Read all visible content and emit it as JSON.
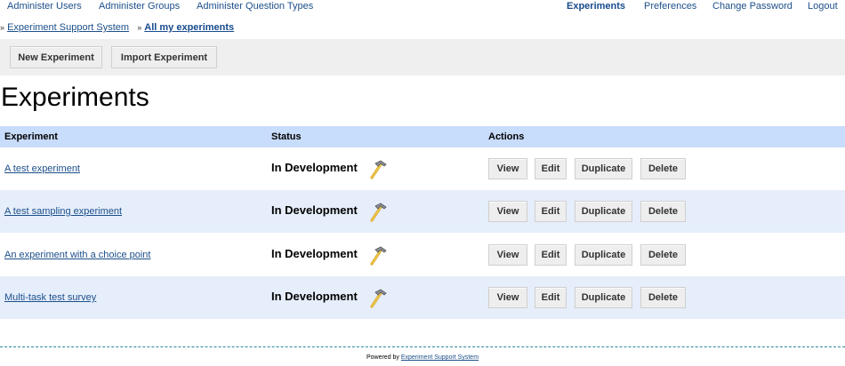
{
  "topnav": {
    "left": [
      "Administer Users",
      "Administer Groups",
      "Administer Question Types"
    ],
    "right": [
      "Experiments",
      "Preferences",
      "Change Password",
      "Logout"
    ]
  },
  "breadcrumb": {
    "separator": "»",
    "items": [
      "Experiment Support System",
      "All my experiments"
    ]
  },
  "toolbar": {
    "new_label": "New Experiment",
    "import_label": "Import Experiment"
  },
  "page_title": "Experiments",
  "table": {
    "headers": [
      "Experiment",
      "Status",
      "Actions"
    ],
    "rows": [
      {
        "name": "A test experiment",
        "status": "In Development"
      },
      {
        "name": "A test sampling experiment",
        "status": "In Development"
      },
      {
        "name": "An experiment with a choice point",
        "status": "In Development"
      },
      {
        "name": "Multi-task test survey",
        "status": "In Development"
      }
    ],
    "actions": [
      "View",
      "Edit",
      "Duplicate",
      "Delete"
    ],
    "status_icon": "hammer-icon"
  },
  "footer": {
    "prefix": "Powered by",
    "link": "Experiment Support System"
  },
  "colors": {
    "link": "#1c4f8a",
    "header_bg": "#c8dcfb",
    "alt_row_bg": "#e6eefb",
    "toolbar_bg": "#efefef"
  }
}
